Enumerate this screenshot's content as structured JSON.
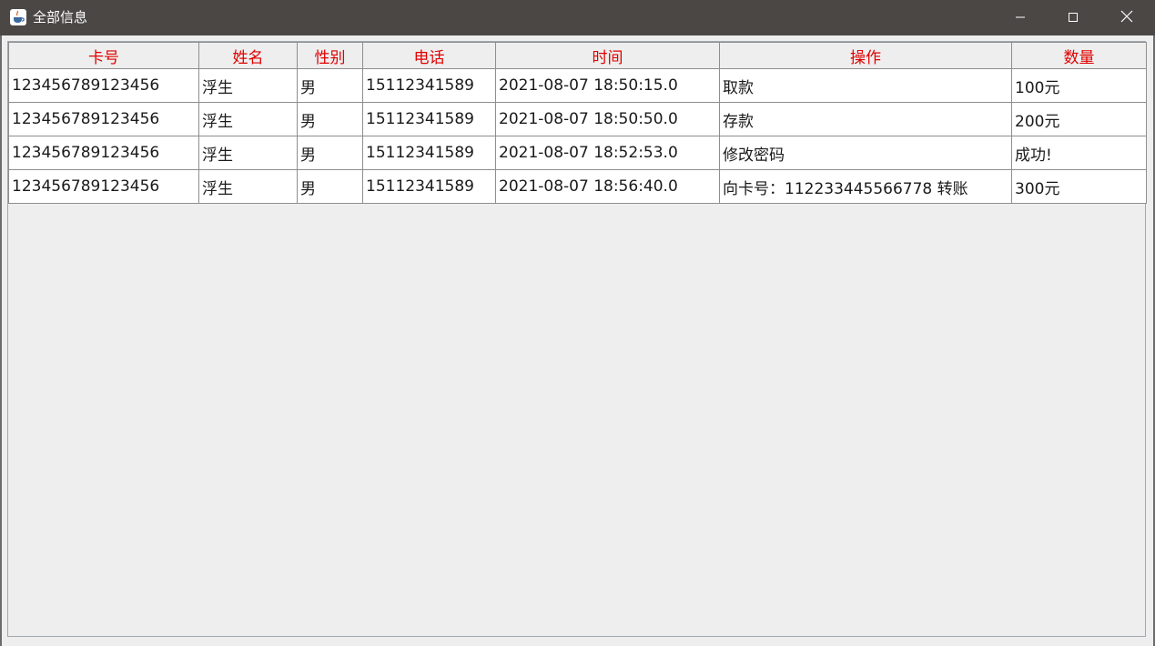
{
  "window": {
    "title": "全部信息",
    "minimize_label": "minimize",
    "maximize_label": "maximize",
    "close_label": "close"
  },
  "table": {
    "columns": [
      "卡号",
      "姓名",
      "性别",
      "电话",
      "时间",
      "操作",
      "数量"
    ],
    "rows": [
      [
        "123456789123456",
        "浮生",
        "男",
        "15112341589",
        "2021-08-07 18:50:15.0",
        "取款",
        "100元"
      ],
      [
        "123456789123456",
        "浮生",
        "男",
        "15112341589",
        "2021-08-07 18:50:50.0",
        "存款",
        "200元"
      ],
      [
        "123456789123456",
        "浮生",
        "男",
        "15112341589",
        "2021-08-07 18:52:53.0",
        "修改密码",
        "成功!"
      ],
      [
        "123456789123456",
        "浮生",
        "男",
        "15112341589",
        "2021-08-07 18:56:40.0",
        "向卡号：112233445566778 转账",
        "300元"
      ]
    ]
  },
  "colors": {
    "titlebar": "#4a4745",
    "header_text": "#e00000",
    "background": "#eeeeee",
    "cell_background": "#ffffff"
  },
  "icons": {
    "app": "java-cup-icon",
    "minimize": "minimize-icon",
    "maximize": "maximize-icon",
    "close": "close-icon"
  }
}
